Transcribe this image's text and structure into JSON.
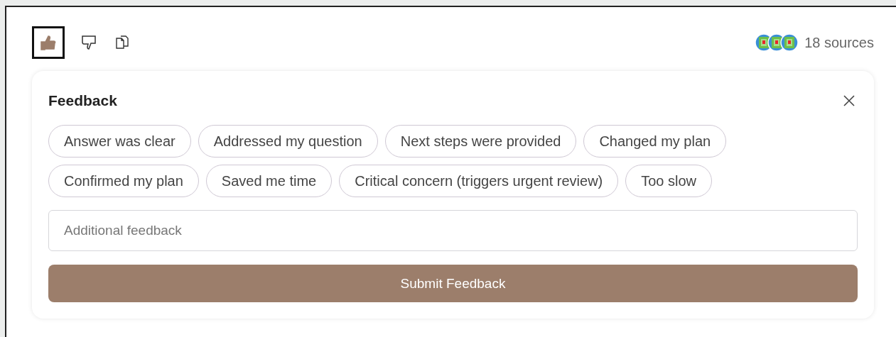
{
  "rating": [
    {
      "kind": "thumbs_up",
      "selected": true
    },
    {
      "kind": "thumbs_down",
      "selected": false
    }
  ],
  "sources": {
    "label": "18 sources"
  },
  "feedback": {
    "title": "Feedback",
    "options": [
      {
        "label": "Answer was clear",
        "selected": false
      },
      {
        "label": "Addressed my question",
        "selected": false
      },
      {
        "label": "Next steps were provided",
        "selected": false
      },
      {
        "label": "Changed my plan",
        "selected": false
      },
      {
        "label": "Confirmed my plan",
        "selected": false
      },
      {
        "label": "Saved me time",
        "selected": false
      },
      {
        "label": "Critical concern (triggers urgent review)",
        "selected": false
      },
      {
        "label": "Too slow",
        "selected": false
      }
    ],
    "input": {
      "placeholder": "Additional feedback"
    },
    "submit": "Submit Feedback"
  }
}
